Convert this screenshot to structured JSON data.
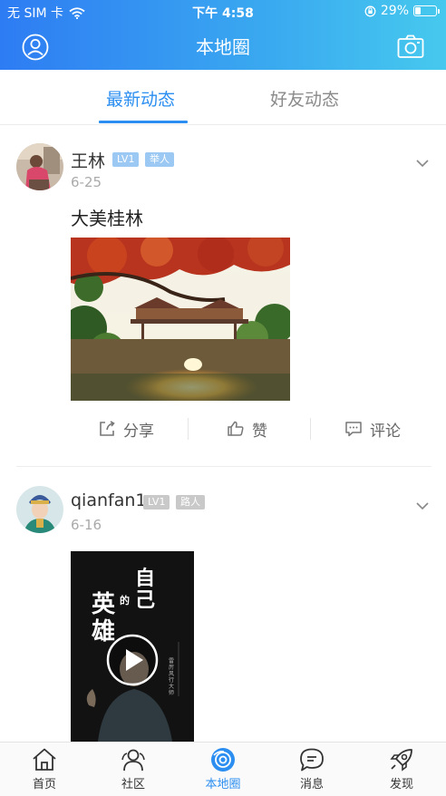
{
  "status_bar": {
    "carrier": "无 SIM 卡",
    "time": "下午 4:58",
    "battery": "29%",
    "battery_level": 0.29
  },
  "navbar": {
    "title": "本地圈"
  },
  "tabs": [
    {
      "label": "最新动态",
      "active": true
    },
    {
      "label": "好友动态",
      "active": false
    }
  ],
  "posts": [
    {
      "username": "王林",
      "level": "LV1",
      "role": "举人",
      "date": "6-25",
      "text": "大美桂林",
      "actions": {
        "share": "分享",
        "like": "赞",
        "comment": "评论"
      }
    },
    {
      "username": "qianfan1",
      "level": "LV1",
      "role": "路人",
      "date": "6-16",
      "video_overlay_text": [
        "自己",
        "的",
        "英雄"
      ],
      "video_small_text": "雷厉风行大师"
    }
  ],
  "bottom_nav": [
    {
      "label": "首页",
      "icon": "home-icon",
      "active": false
    },
    {
      "label": "社区",
      "icon": "community-icon",
      "active": false
    },
    {
      "label": "本地圈",
      "icon": "local-circle-icon",
      "active": true
    },
    {
      "label": "消息",
      "icon": "message-icon",
      "active": false
    },
    {
      "label": "发现",
      "icon": "rocket-icon",
      "active": false
    }
  ],
  "colors": {
    "accent": "#2b8ef0",
    "header_gradient_start": "#2e7cf3",
    "header_gradient_end": "#46c9ee",
    "badge_level": "#9cc8f4",
    "badge_role_post1": "#9cc8f4",
    "badge_role_post2": "#c9c9c9"
  }
}
